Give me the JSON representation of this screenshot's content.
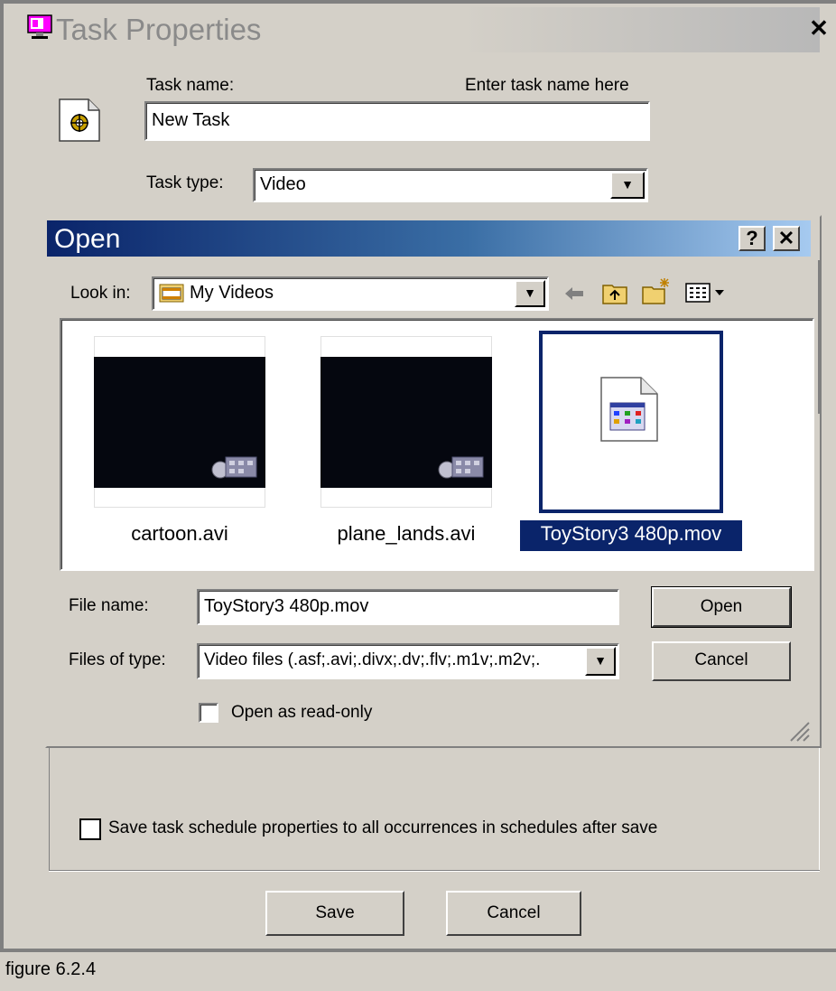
{
  "task_window": {
    "title": "Task Properties",
    "task_name_label": "Task name:",
    "task_name_hint": "Enter task name here",
    "task_name_value": "New Task",
    "task_type_label": "Task type:",
    "task_type_value": "Video",
    "save_schedule_label": "Save task schedule properties to all occurrences in schedules after save",
    "save_button": "Save",
    "cancel_button": "Cancel"
  },
  "open_dialog": {
    "title": "Open",
    "help_button": "?",
    "close_button": "✕",
    "look_in_label": "Look in:",
    "look_in_value": "My Videos",
    "files": [
      {
        "name": "cartoon.avi",
        "selected": false
      },
      {
        "name": "plane_lands.avi",
        "selected": false
      },
      {
        "name": "ToyStory3 480p.mov",
        "selected": true
      }
    ],
    "file_name_label": "File name:",
    "file_name_value": "ToyStory3 480p.mov",
    "files_of_type_label": "Files of type:",
    "files_of_type_value": "Video files (.asf;.avi;.divx;.dv;.flv;.m1v;.m2v;.",
    "read_only_label": "Open as read-only",
    "open_button": "Open",
    "cancel_button": "Cancel"
  },
  "caption": "figure 6.2.4",
  "colors": {
    "face": "#d4d0c8",
    "title_active": "#0a246a",
    "selection": "#0a246a"
  }
}
